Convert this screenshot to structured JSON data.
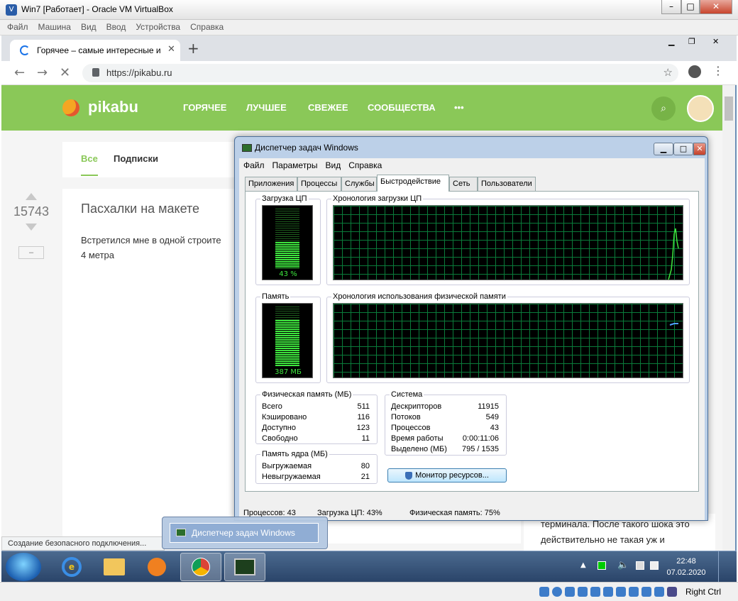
{
  "host": {
    "title": "Win7 [Работает] - Oracle VM VirtualBox",
    "menu": [
      "Файл",
      "Машина",
      "Вид",
      "Ввод",
      "Устройства",
      "Справка"
    ],
    "right_ctrl": "Right Ctrl"
  },
  "chrome": {
    "tab_title": "Горячее – самые интересные и",
    "new_tab": "+",
    "url": "https://pikabu.ru",
    "status": "Создание безопасного подключения..."
  },
  "pikabu": {
    "logo": "pikabu",
    "nav": [
      "ГОРЯЧЕЕ",
      "ЛУЧШЕЕ",
      "СВЕЖЕЕ",
      "СООБЩЕСТВА",
      "•••"
    ],
    "filter_all": "Все",
    "filter_subs": "Подписки",
    "rating": "15743",
    "minus": "–",
    "story_title": "Пасхалки на макете",
    "story_text_1": "Встретился мне в одной строите",
    "story_text_2": "4 метра",
    "side_text_1": "терминала. После такого шока это",
    "side_text_2": "действительно не такая уж и"
  },
  "taskmgr": {
    "title": "Диспетчер задач Windows",
    "menu": [
      "Файл",
      "Параметры",
      "Вид",
      "Справка"
    ],
    "tabs": [
      "Приложения",
      "Процессы",
      "Службы",
      "Быстродействие",
      "Сеть",
      "Пользователи"
    ],
    "cpu_label": "Загрузка ЦП",
    "cpu_value": "43 %",
    "cpu_fraction": 0.43,
    "cpu_history_label": "Хронология загрузки ЦП",
    "mem_label": "Память",
    "mem_value": "387 МБ",
    "mem_fraction": 0.75,
    "mem_history_label": "Хронология использования физической памяти",
    "phys": {
      "title": "Физическая память (МБ)",
      "rows": [
        [
          "Всего",
          "511"
        ],
        [
          "Кэшировано",
          "116"
        ],
        [
          "Доступно",
          "123"
        ],
        [
          "Свободно",
          "11"
        ]
      ]
    },
    "kernel": {
      "title": "Память ядра (МБ)",
      "rows": [
        [
          "Выгружаемая",
          "80"
        ],
        [
          "Невыгружаемая",
          "21"
        ]
      ]
    },
    "system": {
      "title": "Система",
      "rows": [
        [
          "Дескрипторов",
          "11915"
        ],
        [
          "Потоков",
          "549"
        ],
        [
          "Процессов",
          "43"
        ],
        [
          "Время работы",
          "0:00:11:06"
        ],
        [
          "Выделено (МБ)",
          "795 / 1535"
        ]
      ]
    },
    "monitor_button": "Монитор ресурсов...",
    "status": [
      "Процессов: 43",
      "Загрузка ЦП: 43%",
      "Физическая память: 75%"
    ]
  },
  "taskbar": {
    "popup": "Диспетчер задач Windows",
    "time": "22:48",
    "date": "07.02.2020"
  }
}
